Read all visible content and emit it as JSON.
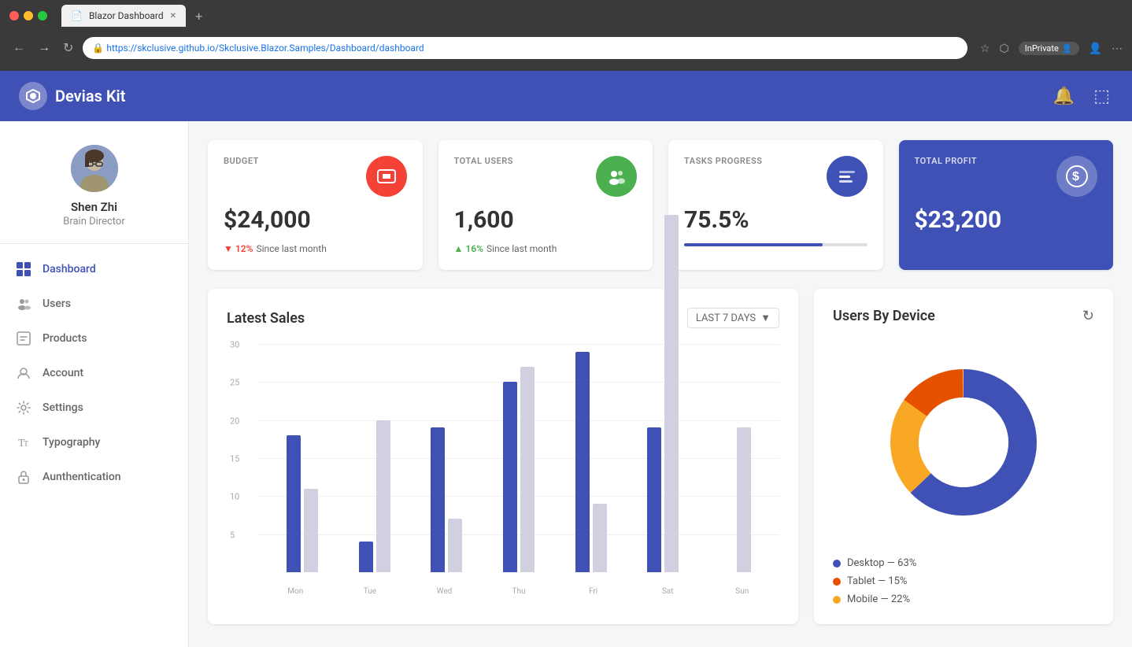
{
  "browser": {
    "tab_title": "Blazor Dashboard",
    "url": "https://skclusive.github.io/Skclusive.Blazor.Samples/Dashboard/dashboard",
    "inprivate_label": "InPrivate"
  },
  "topnav": {
    "logo_text": "Devias Kit",
    "bell_icon": "🔔",
    "exit_icon": "⬚"
  },
  "sidebar": {
    "profile": {
      "name": "Shen Zhi",
      "role": "Brain Director"
    },
    "nav_items": [
      {
        "id": "dashboard",
        "label": "Dashboard",
        "active": true
      },
      {
        "id": "users",
        "label": "Users",
        "active": false
      },
      {
        "id": "products",
        "label": "Products",
        "active": false
      },
      {
        "id": "account",
        "label": "Account",
        "active": false
      },
      {
        "id": "settings",
        "label": "Settings",
        "active": false
      },
      {
        "id": "typography",
        "label": "Typography",
        "active": false
      },
      {
        "id": "authentication",
        "label": "Aunthentication",
        "active": false
      }
    ]
  },
  "stats": {
    "budget": {
      "label": "BUDGET",
      "value": "$24,000",
      "icon_color": "#f44336",
      "change_dir": "down",
      "change_pct": "12%",
      "change_text": "Since last month"
    },
    "total_users": {
      "label": "TOTAL USERS",
      "value": "1,600",
      "icon_color": "#4caf50",
      "change_dir": "up",
      "change_pct": "16%",
      "change_text": "Since last month"
    },
    "tasks_progress": {
      "label": "TASKS PROGRESS",
      "value": "75.5%",
      "icon_color": "#3f51b5",
      "progress": 75.5
    },
    "total_profit": {
      "label": "TOTAL PROFIT",
      "value": "$23,200",
      "icon_color": "rgba(255,255,255,0.3)"
    }
  },
  "latest_sales": {
    "title": "Latest Sales",
    "filter_label": "LAST 7 DAYS",
    "x_labels": [
      "Mon",
      "Tue",
      "Wed",
      "Thu",
      "Fri",
      "Sat",
      "Sun"
    ],
    "bars_blue": [
      18,
      4,
      19,
      25,
      29,
      19,
      0
    ],
    "bars_gray": [
      11,
      20,
      7,
      27,
      9,
      47,
      19
    ],
    "y_labels": [
      30,
      25,
      20,
      15,
      10,
      5
    ],
    "y_max": 30
  },
  "users_by_device": {
    "title": "Users By Device",
    "segments": [
      {
        "label": "Desktop",
        "value": 63,
        "color": "#3f51b5"
      },
      {
        "label": "Tablet",
        "value": 15,
        "color": "#e65100"
      },
      {
        "label": "Mobile",
        "value": 22,
        "color": "#f9a825"
      }
    ]
  }
}
